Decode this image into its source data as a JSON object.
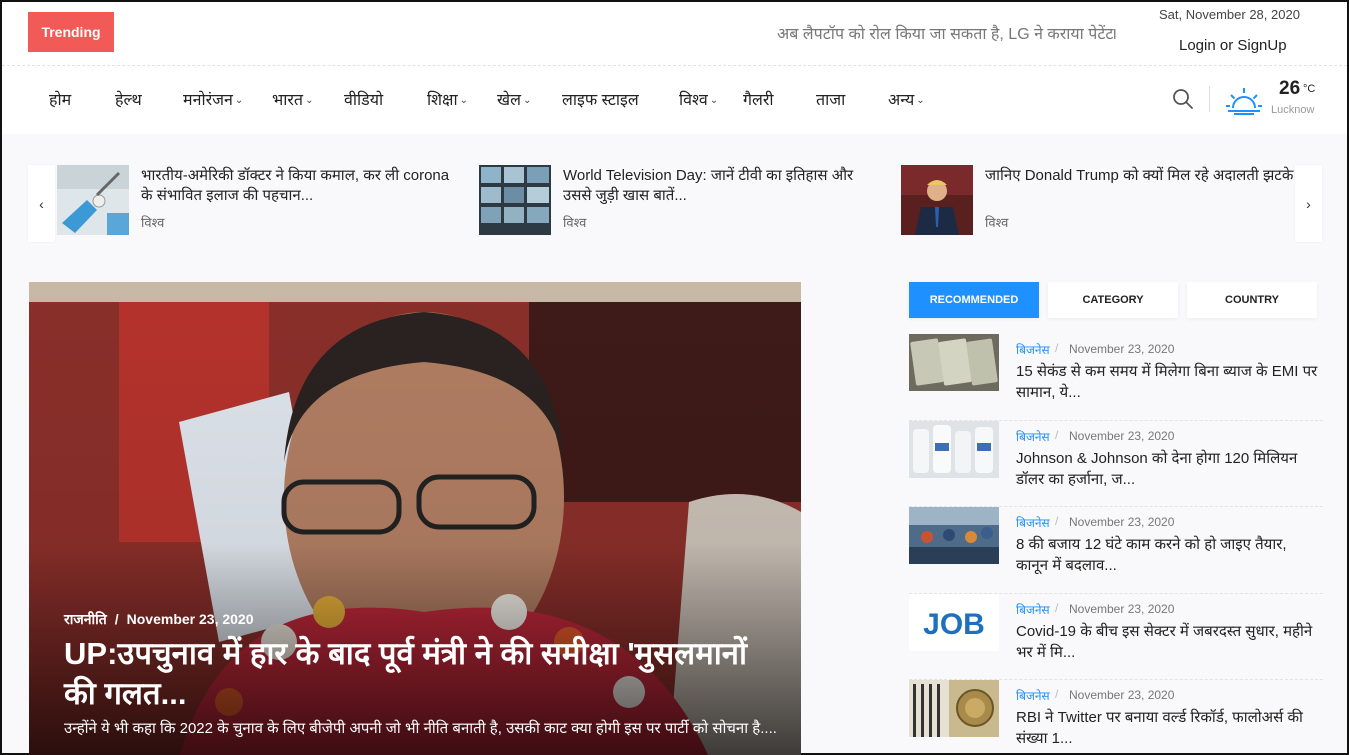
{
  "topbar": {
    "trending_label": "Trending",
    "ticker_text": "अब लैपटॉप को रोल किया जा सकता है, LG ने कराया पेटेंट",
    "ticker_separator": "।",
    "date": "Sat, November 28, 2020",
    "login_label": "Login or SignUp"
  },
  "nav": {
    "items": [
      {
        "label": "होम"
      },
      {
        "label": "हेल्थ"
      },
      {
        "label": "मनोरंजन",
        "has_dropdown": true
      },
      {
        "label": "भारत",
        "has_dropdown": true
      },
      {
        "label": "वीडियो"
      },
      {
        "label": "शिक्षा",
        "has_dropdown": true
      },
      {
        "label": "खेल",
        "has_dropdown": true
      },
      {
        "label": "लाइफ स्टाइल"
      },
      {
        "label": "विश्व",
        "has_dropdown": true
      },
      {
        "label": "गैलरी"
      },
      {
        "label": "ताजा"
      },
      {
        "label": "अन्य",
        "has_dropdown": true
      }
    ],
    "chevron": "⌄",
    "weather": {
      "temperature": "26",
      "unit": "°C",
      "city": "Lucknow",
      "icon": "sunrise-weather-icon"
    }
  },
  "carousel": {
    "prev_glyph": "‹",
    "next_glyph": "›",
    "items": [
      {
        "title": "भारतीय-अमेरिकी डॉक्टर ने किया कमाल, कर ली corona के संभावित इलाज की पहचान...",
        "category": "विश्व"
      },
      {
        "title": "World Television Day: जानें टीवी का इतिहास और उससे जुड़ी खास बातें...",
        "category": "विश्व"
      },
      {
        "title": "जानिए Donald Trump को क्यों मिल रहे अदालती झटके",
        "category": "विश्व"
      }
    ]
  },
  "hero": {
    "category": "राजनीति",
    "separator": "/",
    "date": "November 23, 2020",
    "title": "UP:उपचुनाव में हार के बाद पूर्व मंत्री ने की समीक्षा 'मुसलमानों की गलत...",
    "description": "उन्होंने ये भी कहा कि 2022 के चुनाव के लिए बीजेपी अपनी जो भी नीति बनाती है, उसकी काट क्या होगी इस पर पार्टी को सोचना है...."
  },
  "sidebar": {
    "tabs": [
      {
        "label": "RECOMMENDED",
        "active": true
      },
      {
        "label": "CATEGORY",
        "active": false
      },
      {
        "label": "COUNTRY",
        "active": false
      }
    ],
    "separator": "/",
    "items": [
      {
        "category": "बिजनेस",
        "date": "November 23, 2020",
        "title": "15 सेकंड से कम समय में मिलेगा बिना ब्याज के EMI पर सामान, ये..."
      },
      {
        "category": "बिजनेस",
        "date": "November 23, 2020",
        "title": "Johnson & Johnson को देना होगा 120 मिलियन डॉलर का हर्जाना, ज..."
      },
      {
        "category": "बिजनेस",
        "date": "November 23, 2020",
        "title": "8 की बजाय 12 घंटे काम करने को हो जाइए तैयार, कानून में बदलाव..."
      },
      {
        "category": "बिजनेस",
        "date": "November 23, 2020",
        "title": "Covid-19 के बीच इस सेक्टर में जबरदस्त सुधार, महीने भर में मि..."
      },
      {
        "category": "बिजनेस",
        "date": "November 23, 2020",
        "title": "RBI ने Twitter पर बनाया वर्ल्ड रिकॉर्ड, फालोअर्स की संख्या 1..."
      }
    ],
    "job_thumb_text": "JOB"
  },
  "colors": {
    "trending_bg": "#f15a56",
    "accent_blue": "#1e90ff"
  }
}
